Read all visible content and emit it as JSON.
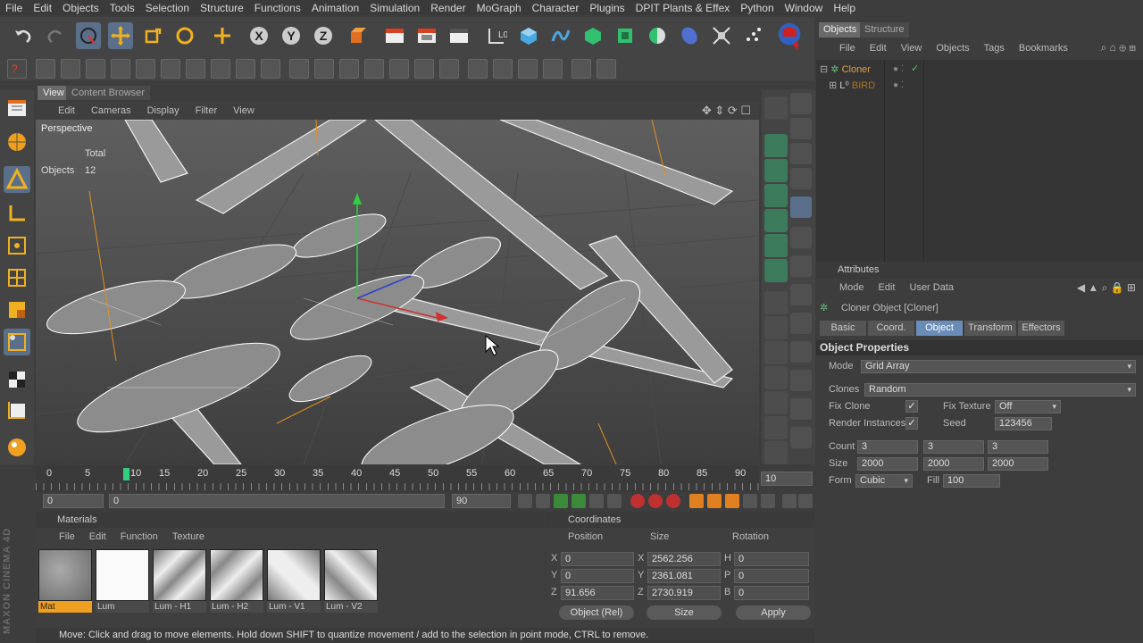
{
  "menubar": [
    "File",
    "Edit",
    "Objects",
    "Tools",
    "Selection",
    "Structure",
    "Functions",
    "Animation",
    "Simulation",
    "Render",
    "MoGraph",
    "Character",
    "Plugins",
    "DPIT Plants & Effex",
    "Python",
    "Window",
    "Help"
  ],
  "viewport": {
    "tabs": [
      "View",
      "Content Browser"
    ],
    "menu": [
      "Edit",
      "Cameras",
      "Display",
      "Filter",
      "View"
    ],
    "camera_label": "Perspective",
    "stats_total": "Total",
    "stats_objects_label": "Objects",
    "stats_objects_value": "12"
  },
  "timeline": {
    "ticks": [
      "0",
      "5",
      "10",
      "15",
      "20",
      "25",
      "30",
      "35",
      "40",
      "45",
      "50",
      "55",
      "60",
      "65",
      "70",
      "75",
      "80",
      "85",
      "90"
    ],
    "end_field": "10",
    "current_frame": "0",
    "range_start": "0",
    "range_end": "90",
    "max_frame": "90"
  },
  "materials": {
    "title": "Materials",
    "menu": [
      "File",
      "Edit",
      "Function",
      "Texture"
    ],
    "items": [
      {
        "label": "Mat"
      },
      {
        "label": "Lum"
      },
      {
        "label": "Lum - H1"
      },
      {
        "label": "Lum - H2"
      },
      {
        "label": "Lum - V1"
      },
      {
        "label": "Lum - V2"
      }
    ]
  },
  "coordinates": {
    "title": "Coordinates",
    "headers": [
      "Position",
      "Size",
      "Rotation"
    ],
    "rows": [
      {
        "pos_axis": "X",
        "pos": "0",
        "size_axis": "X",
        "size": "2562.256",
        "rot_axis": "H",
        "rot": "0"
      },
      {
        "pos_axis": "Y",
        "pos": "0",
        "size_axis": "Y",
        "size": "2361.081",
        "rot_axis": "P",
        "rot": "0"
      },
      {
        "pos_axis": "Z",
        "pos": "91.656",
        "size_axis": "Z",
        "size": "2730.919",
        "rot_axis": "B",
        "rot": "0"
      }
    ],
    "mode_select": "Object (Rel)",
    "size_select": "Size",
    "apply_label": "Apply"
  },
  "status": "Move: Click and drag to move elements. Hold down SHIFT to quantize movement / add to the selection in point mode, CTRL to remove.",
  "brand": "MAXON CINEMA 4D",
  "objects_panel": {
    "tabs": [
      "Objects",
      "Structure"
    ],
    "menu": [
      "File",
      "Edit",
      "View",
      "Objects",
      "Tags",
      "Bookmarks"
    ],
    "tree": [
      {
        "name": "Cloner",
        "color": "#e0a040"
      },
      {
        "name": "BIRD",
        "color": "#b07020"
      }
    ]
  },
  "attributes": {
    "title": "Attributes",
    "menu": [
      "Mode",
      "Edit",
      "User Data"
    ],
    "object_title": "Cloner Object [Cloner]",
    "tabs": [
      "Basic",
      "Coord.",
      "Object",
      "Transform",
      "Effectors"
    ],
    "section": "Object Properties",
    "mode_label": "Mode",
    "mode_value": "Grid Array",
    "clones_label": "Clones",
    "clones_value": "Random",
    "fix_clone_label": "Fix Clone",
    "fix_texture_label": "Fix Texture",
    "fix_texture_value": "Off",
    "render_instances_label": "Render Instances",
    "seed_label": "Seed",
    "seed_value": "123456",
    "count_label": "Count",
    "count_values": [
      "3",
      "3",
      "3"
    ],
    "size_label": "Size",
    "size_values": [
      "2000",
      "2000",
      "2000"
    ],
    "form_label": "Form",
    "form_value": "Cubic",
    "fill_label": "Fill",
    "fill_value": "100"
  },
  "colors": {
    "accent": "#6a8cb8",
    "selected_tool": "#5a6f8a",
    "mat_highlight": "#f0a020"
  }
}
